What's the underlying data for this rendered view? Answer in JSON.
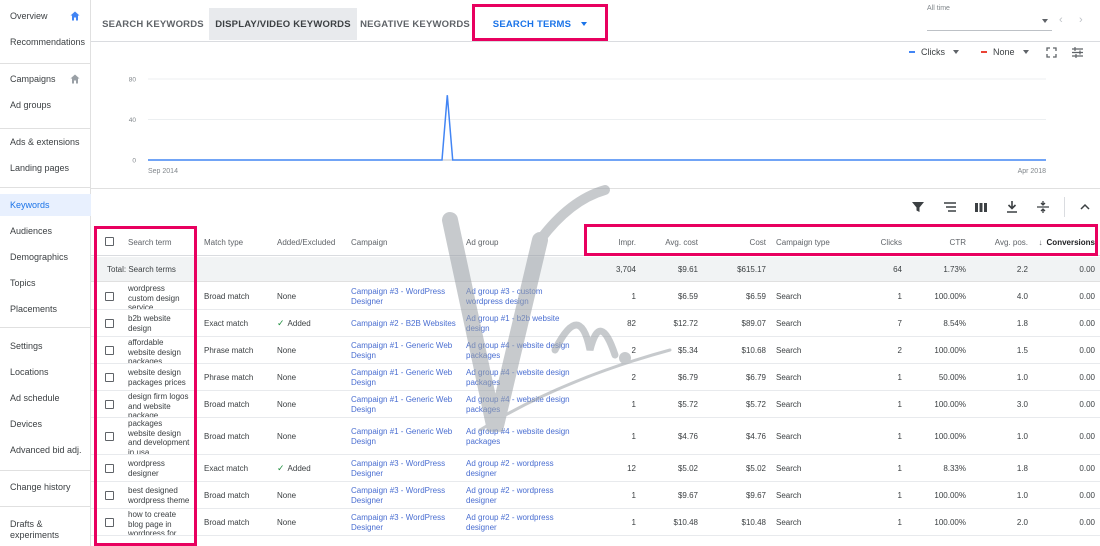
{
  "sidebar": {
    "items": [
      {
        "label": "Overview",
        "home": true
      },
      {
        "label": "Recommendations"
      },
      {
        "label": "Campaigns",
        "home": true
      },
      {
        "label": "Ad groups"
      },
      {
        "label": "Ads & extensions"
      },
      {
        "label": "Landing pages"
      },
      {
        "label": "Keywords",
        "active": true
      },
      {
        "label": "Audiences"
      },
      {
        "label": "Demographics"
      },
      {
        "label": "Topics"
      },
      {
        "label": "Placements"
      },
      {
        "label": "Settings"
      },
      {
        "label": "Locations"
      },
      {
        "label": "Ad schedule"
      },
      {
        "label": "Devices"
      },
      {
        "label": "Advanced bid adj."
      },
      {
        "label": "Change history"
      },
      {
        "label": "Drafts &"
      },
      {
        "label": "experiments"
      }
    ]
  },
  "tabs": [
    "SEARCH KEYWORDS",
    "DISPLAY/VIDEO KEYWORDS",
    "NEGATIVE KEYWORDS",
    "SEARCH TERMS"
  ],
  "date_range": {
    "label": "All time"
  },
  "chart_controls": {
    "metric1": "Clicks",
    "metric2": "None",
    "metric1_color": "#4285f4",
    "metric2_color": "#ea4335"
  },
  "chart_data": {
    "type": "line",
    "series": [
      {
        "name": "Clicks",
        "values": [
          0,
          0,
          0,
          0,
          0,
          0,
          0,
          0,
          0,
          0,
          0,
          0,
          0,
          0,
          0,
          0,
          0,
          0,
          0,
          0,
          0,
          0,
          0,
          0,
          0,
          0,
          0,
          0,
          0,
          0,
          0,
          0,
          0,
          0,
          0,
          0,
          0,
          0,
          0,
          0,
          0,
          0,
          0,
          0,
          0,
          0,
          0,
          0,
          0,
          0,
          0,
          0,
          0,
          0,
          0,
          0,
          64,
          0,
          0,
          0,
          0,
          0,
          0,
          0,
          0,
          0,
          0,
          0,
          0,
          0,
          0,
          0,
          0,
          0,
          0,
          0,
          0,
          0,
          0,
          0,
          0,
          0,
          0,
          0,
          0,
          0,
          0,
          0,
          0,
          0,
          0,
          0,
          0,
          0,
          0,
          0,
          0,
          0,
          0,
          0,
          0,
          0,
          0,
          0,
          0,
          0,
          0,
          0,
          0,
          0,
          0,
          0,
          0,
          0,
          0,
          0,
          0,
          0,
          0,
          0,
          0,
          0,
          0,
          0,
          0,
          0,
          0,
          0,
          0,
          0,
          0,
          0,
          0,
          0,
          0,
          0,
          0,
          0,
          0,
          0,
          0,
          0,
          0,
          0,
          0,
          0,
          0,
          0,
          0,
          0,
          0,
          0,
          0,
          0,
          0,
          0,
          0,
          0,
          0,
          0,
          0,
          0,
          0,
          0,
          0,
          0,
          0,
          0,
          0
        ]
      }
    ],
    "x_start_label": "Sep 2014",
    "x_end_label": "Apr 2018",
    "y_ticks": [
      "80",
      "40",
      "0"
    ],
    "ylim": [
      0,
      80
    ],
    "grid": true
  },
  "table": {
    "headers": {
      "search_term": "Search term",
      "match_type": "Match type",
      "added_excluded": "Added/Excluded",
      "campaign": "Campaign",
      "ad_group": "Ad group",
      "impr": "Impr.",
      "avg_cost": "Avg. cost",
      "cost": "Cost",
      "campaign_type": "Campaign type",
      "clicks": "Clicks",
      "ctr": "CTR",
      "avg_pos": "Avg. pos.",
      "conversions": "Conversions"
    },
    "total": {
      "label": "Total: Search terms",
      "impr": "3,704",
      "avg_cost": "$9.61",
      "cost": "$615.17",
      "clicks": "64",
      "ctr": "1.73%",
      "avg_pos": "2.2",
      "conversions": "0.00"
    },
    "rows": [
      {
        "term": "wordpress custom design service",
        "match": "Broad match",
        "added": "None",
        "added_check": false,
        "campaign": "Campaign #3 - WordPress Designer",
        "adgroup": "Ad group #3 - custom wordpress design",
        "impr": "1",
        "avg_cost": "$6.59",
        "cost": "$6.59",
        "ctype": "Search",
        "clicks": "1",
        "ctr": "100.00%",
        "pos": "4.0",
        "conv": "0.00"
      },
      {
        "term": "b2b website design",
        "match": "Exact match",
        "added": "Added",
        "added_check": true,
        "campaign": "Campaign #2 - B2B Websites",
        "adgroup": "Ad group #1 - b2b website design",
        "impr": "82",
        "avg_cost": "$12.72",
        "cost": "$89.07",
        "ctype": "Search",
        "clicks": "7",
        "ctr": "8.54%",
        "pos": "1.8",
        "conv": "0.00"
      },
      {
        "term": "affordable website design packages",
        "match": "Phrase match",
        "added": "None",
        "added_check": false,
        "campaign": "Campaign #1 - Generic Web Design",
        "adgroup": "Ad group #4 - website design packages",
        "impr": "2",
        "avg_cost": "$5.34",
        "cost": "$10.68",
        "ctype": "Search",
        "clicks": "2",
        "ctr": "100.00%",
        "pos": "1.5",
        "conv": "0.00"
      },
      {
        "term": "website design packages prices",
        "match": "Phrase match",
        "added": "None",
        "added_check": false,
        "campaign": "Campaign #1 - Generic Web Design",
        "adgroup": "Ad group #4 - website design packages",
        "impr": "2",
        "avg_cost": "$6.79",
        "cost": "$6.79",
        "ctype": "Search",
        "clicks": "1",
        "ctr": "50.00%",
        "pos": "1.0",
        "conv": "0.00"
      },
      {
        "term": "design firm logos and website package",
        "match": "Broad match",
        "added": "None",
        "added_check": false,
        "campaign": "Campaign #1 - Generic Web Design",
        "adgroup": "Ad group #4 - website design packages",
        "impr": "1",
        "avg_cost": "$5.72",
        "cost": "$5.72",
        "ctype": "Search",
        "clicks": "1",
        "ctr": "100.00%",
        "pos": "3.0",
        "conv": "0.00"
      },
      {
        "term": "packages website design and development in usa",
        "match": "Broad match",
        "added": "None",
        "added_check": false,
        "campaign": "Campaign #1 - Generic Web Design",
        "adgroup": "Ad group #4 - website design packages",
        "impr": "1",
        "avg_cost": "$4.76",
        "cost": "$4.76",
        "ctype": "Search",
        "clicks": "1",
        "ctr": "100.00%",
        "pos": "1.0",
        "conv": "0.00"
      },
      {
        "term": "wordpress designer",
        "match": "Exact match",
        "added": "Added",
        "added_check": true,
        "campaign": "Campaign #3 - WordPress Designer",
        "adgroup": "Ad group #2 - wordpress designer",
        "impr": "12",
        "avg_cost": "$5.02",
        "cost": "$5.02",
        "ctype": "Search",
        "clicks": "1",
        "ctr": "8.33%",
        "pos": "1.8",
        "conv": "0.00"
      },
      {
        "term": "best designed wordpress theme",
        "match": "Broad match",
        "added": "None",
        "added_check": false,
        "campaign": "Campaign #3 - WordPress Designer",
        "adgroup": "Ad group #2 - wordpress designer",
        "impr": "1",
        "avg_cost": "$9.67",
        "cost": "$9.67",
        "ctype": "Search",
        "clicks": "1",
        "ctr": "100.00%",
        "pos": "1.0",
        "conv": "0.00"
      },
      {
        "term": "how to create blog page in wordpress for designers",
        "match": "Broad match",
        "added": "None",
        "added_check": false,
        "campaign": "Campaign #3 - WordPress Designer",
        "adgroup": "Ad group #2 - wordpress designer",
        "impr": "1",
        "avg_cost": "$10.48",
        "cost": "$10.48",
        "ctype": "Search",
        "clicks": "1",
        "ctr": "100.00%",
        "pos": "2.0",
        "conv": "0.00"
      }
    ]
  }
}
